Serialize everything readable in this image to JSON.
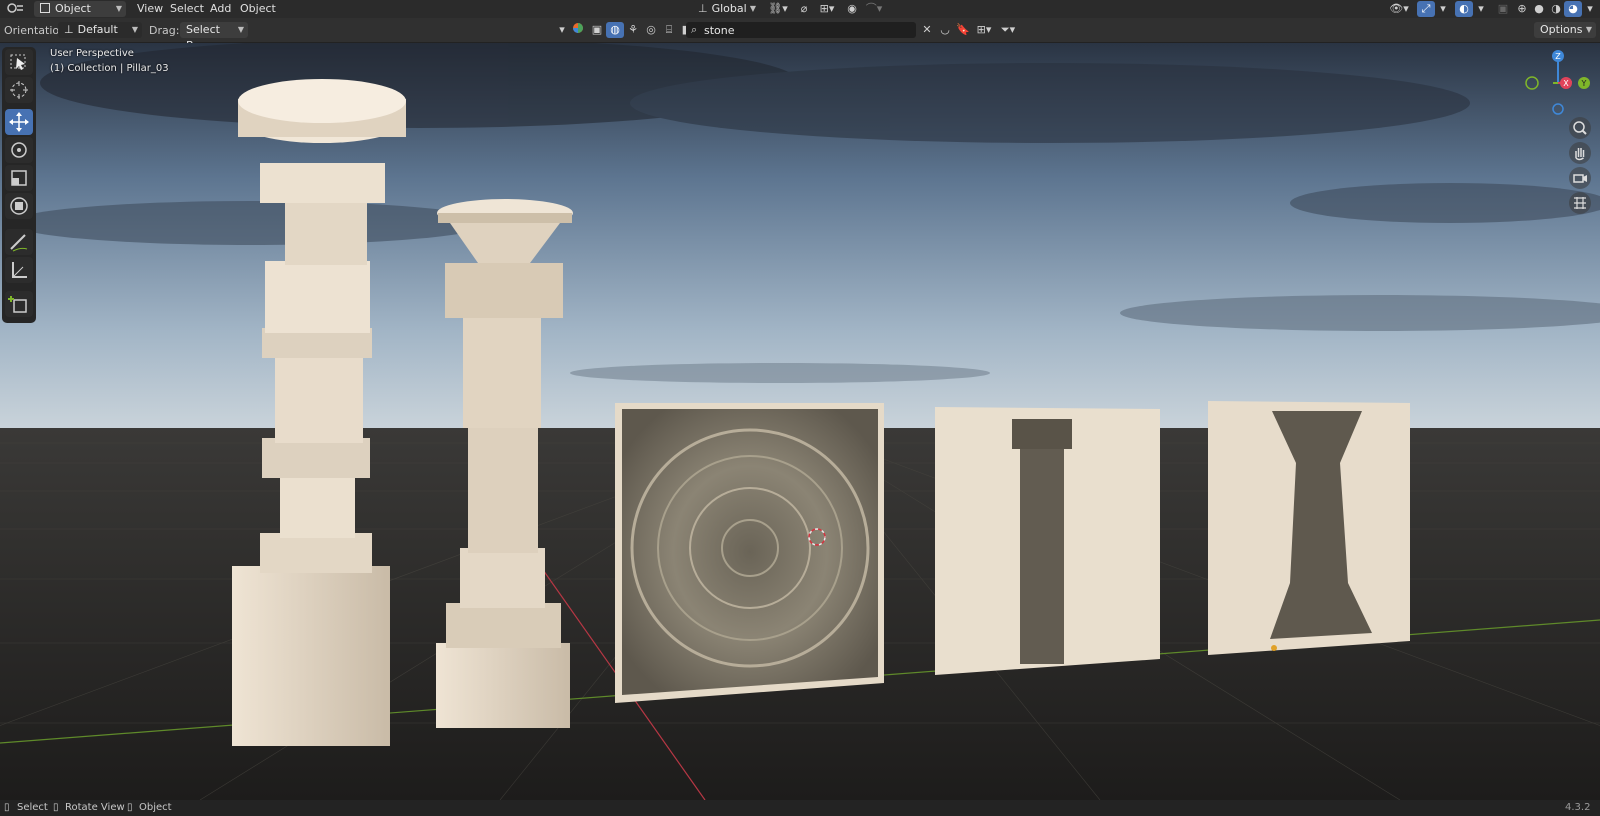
{
  "menubar": {
    "mode": "Object Mode",
    "menus": [
      "View",
      "Select",
      "Add",
      "Object"
    ],
    "transform_orientation": "Global"
  },
  "headerbar": {
    "orientation_label": "Orientation:",
    "orientation_value": "Default",
    "drag_label": "Drag:",
    "drag_value": "Select Box",
    "search_value": "stone",
    "options_label": "Options"
  },
  "viewport": {
    "view_name": "User Perspective",
    "collection_info": "(1) Collection | Pillar_03",
    "gizmo_axes": {
      "z": "Z",
      "x": "X",
      "y": "Y"
    }
  },
  "statusbar": {
    "items": [
      "Select",
      "Rotate View",
      "Object"
    ],
    "version": "4.3.2"
  },
  "colors": {
    "accent": "#4772b3",
    "x_axis": "#e0435a",
    "y_axis": "#7fb62a",
    "z_axis": "#3f88d8"
  },
  "icons": [
    "editor-type-icon",
    "object-mode-icon",
    "pivot-icon",
    "snap-icon",
    "proportional-icon",
    "search-icon",
    "filter-icon",
    "visibility-icon",
    "gizmo-icon",
    "overlay-icon",
    "xray-icon",
    "wireframe-shading-icon",
    "solid-shading-icon",
    "material-shading-icon",
    "rendered-shading-icon",
    "select-box-tool-icon",
    "cursor-tool-icon",
    "move-tool-icon",
    "rotate-tool-icon",
    "scale-tool-icon",
    "transform-tool-icon",
    "annotate-tool-icon",
    "measure-tool-icon",
    "add-cube-tool-icon",
    "zoom-icon",
    "pan-icon",
    "camera-icon",
    "grid-icon"
  ]
}
